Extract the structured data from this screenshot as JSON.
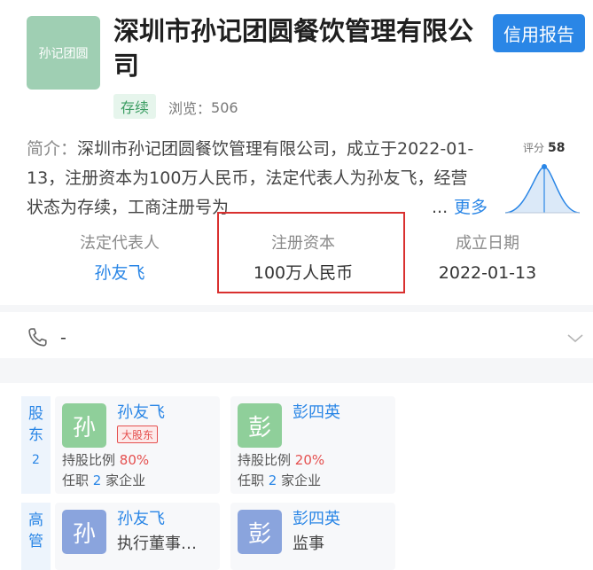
{
  "header": {
    "logo_text": "孙记团圆",
    "company_name": "深圳市孙记团圆餐饮管理有限公司",
    "credit_report_label": "信用报告",
    "status": "存续",
    "views_label": "浏览：",
    "views_count": "506"
  },
  "intro": {
    "label": "简介：",
    "text": "深圳市孙记团圆餐饮管理有限公司，成立于2022-01-13，注册资本为100万人民币，法定代表人为孙友飞，经营状态为存续，工商注册号为",
    "ellipsis": "...",
    "more_label": "更多"
  },
  "score": {
    "label": "评分",
    "value": "58"
  },
  "key_info": {
    "legal_rep_label": "法定代表人",
    "legal_rep_value": "孙友飞",
    "capital_label": "注册资本",
    "capital_value": "100万人民币",
    "founded_label": "成立日期",
    "founded_value": "2022-01-13"
  },
  "contact": {
    "phone": "-"
  },
  "shareholders": {
    "label_chars": [
      "股",
      "东"
    ],
    "count": "2",
    "items": [
      {
        "avatar": "孙",
        "name": "孙友飞",
        "tag": "大股东",
        "ratio_label": "持股比例",
        "ratio": "80%",
        "job_prefix": "任职",
        "job_count": "2",
        "job_suffix": "家企业"
      },
      {
        "avatar": "彭",
        "name": "彭四英",
        "ratio_label": "持股比例",
        "ratio": "20%",
        "job_prefix": "任职",
        "job_count": "2",
        "job_suffix": "家企业"
      }
    ]
  },
  "executives": {
    "label_chars": [
      "高",
      "管"
    ],
    "items": [
      {
        "avatar": "孙",
        "name": "孙友飞",
        "role": "执行董事…"
      },
      {
        "avatar": "彭",
        "name": "彭四英",
        "role": "监事"
      }
    ]
  },
  "colors": {
    "accent": "#2a86e6",
    "highlight": "#d9302f",
    "status_green": "#3b9d62",
    "danger": "#e5504f"
  }
}
